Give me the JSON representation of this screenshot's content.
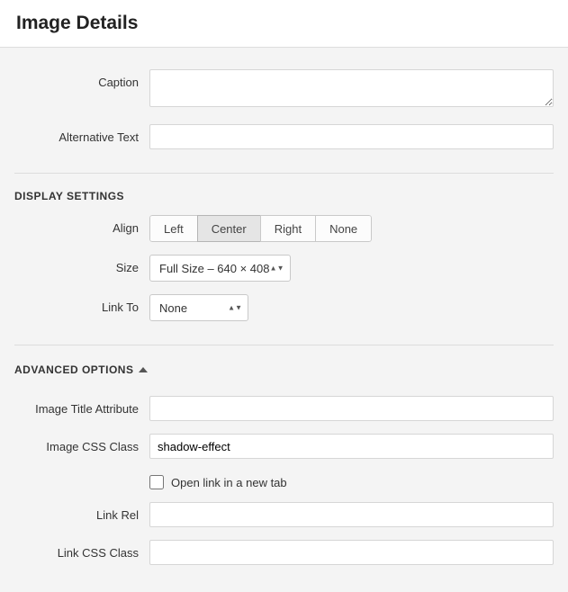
{
  "header": {
    "title": "Image Details"
  },
  "fields": {
    "caption_label": "Caption",
    "caption_value": "",
    "alt_label": "Alternative Text",
    "alt_value": ""
  },
  "display": {
    "section_title": "DISPLAY SETTINGS",
    "align_label": "Align",
    "align_options": {
      "left": "Left",
      "center": "Center",
      "right": "Right",
      "none": "None"
    },
    "align_selected": "center",
    "size_label": "Size",
    "size_value": "Full Size – 640 × 408",
    "linkto_label": "Link To",
    "linkto_value": "None"
  },
  "advanced": {
    "toggle_label": "ADVANCED OPTIONS",
    "title_attr_label": "Image Title Attribute",
    "title_attr_value": "",
    "css_class_label": "Image CSS Class",
    "css_class_value": "shadow-effect",
    "open_new_tab_label": "Open link in a new tab",
    "open_new_tab_checked": false,
    "link_rel_label": "Link Rel",
    "link_rel_value": "",
    "link_css_label": "Link CSS Class",
    "link_css_value": ""
  }
}
